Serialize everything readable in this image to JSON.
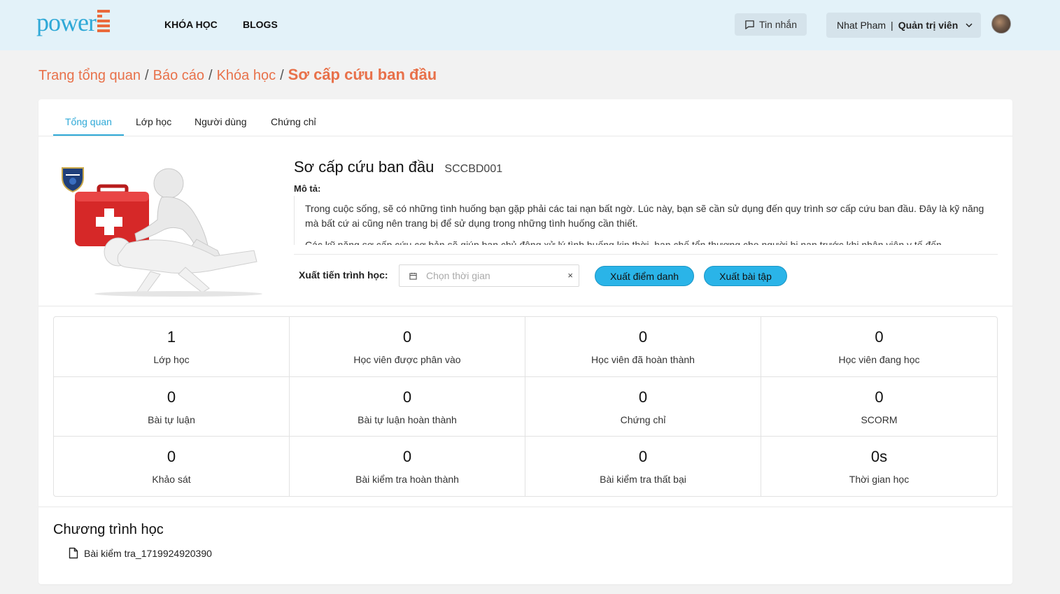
{
  "header": {
    "logo_text": "power",
    "nav": [
      {
        "label": "KHÓA HỌC"
      },
      {
        "label": "BLOGS"
      }
    ],
    "messages_label": "Tin nhắn",
    "user_name": "Nhat Pham",
    "user_separator": "|",
    "user_role": "Quản trị viên"
  },
  "breadcrumb": {
    "items": [
      "Trang tổng quan",
      "Báo cáo",
      "Khóa học"
    ],
    "separator": "/",
    "current": "Sơ cấp cứu ban đầu"
  },
  "tabs": [
    {
      "label": "Tổng quan",
      "active": true
    },
    {
      "label": "Lớp học",
      "active": false
    },
    {
      "label": "Người dùng",
      "active": false
    },
    {
      "label": "Chứng chỉ",
      "active": false
    }
  ],
  "course": {
    "title": "Sơ cấp cứu ban đầu",
    "code": "SCCBD001",
    "description_label": "Mô tả:",
    "description_paragraphs": [
      "Trong cuộc sống, sẽ có những tình huống bạn gặp phải các tai nạn bất ngờ. Lúc này, bạn sẽ cần sử dụng đến quy trình sơ cấp cứu ban đầu. Đây là kỹ năng mà bất cứ ai cũng nên trang bị để sử dụng trong những tình huống cần thiết.",
      "Các kỹ năng sơ cấp cứu cơ bản sẽ giúp bạn chủ động xử lý tình huống kịp thời, hạn chế tổn thương cho người bị nạn trước khi nhân viên y tế đến."
    ]
  },
  "export": {
    "label": "Xuất tiến trình học:",
    "date_placeholder": "Chọn thời gian",
    "clear_symbol": "×",
    "attendance_button": "Xuất điểm danh",
    "assignment_button": "Xuất bài tập"
  },
  "stats": [
    {
      "value": "1",
      "label": "Lớp học"
    },
    {
      "value": "0",
      "label": "Học viên được phân vào"
    },
    {
      "value": "0",
      "label": "Học viên đã hoàn thành"
    },
    {
      "value": "0",
      "label": "Học viên đang học"
    },
    {
      "value": "0",
      "label": "Bài tự luận"
    },
    {
      "value": "0",
      "label": "Bài tự luận hoàn thành"
    },
    {
      "value": "0",
      "label": "Chứng chỉ"
    },
    {
      "value": "0",
      "label": "SCORM"
    },
    {
      "value": "0",
      "label": "Khảo sát"
    },
    {
      "value": "0",
      "label": "Bài kiểm tra hoàn thành"
    },
    {
      "value": "0",
      "label": "Bài kiểm tra thất bại"
    },
    {
      "value": "0s",
      "label": "Thời gian học"
    }
  ],
  "program": {
    "title": "Chương trình học",
    "items": [
      {
        "label": "Bài kiểm tra_1719924920390",
        "icon": "file-icon"
      }
    ]
  },
  "colors": {
    "header_bg": "#e3f2f9",
    "accent_blue": "#2fa9d7",
    "breadcrumb_orange": "#e8714a",
    "button_blue": "#2ab4e8"
  }
}
